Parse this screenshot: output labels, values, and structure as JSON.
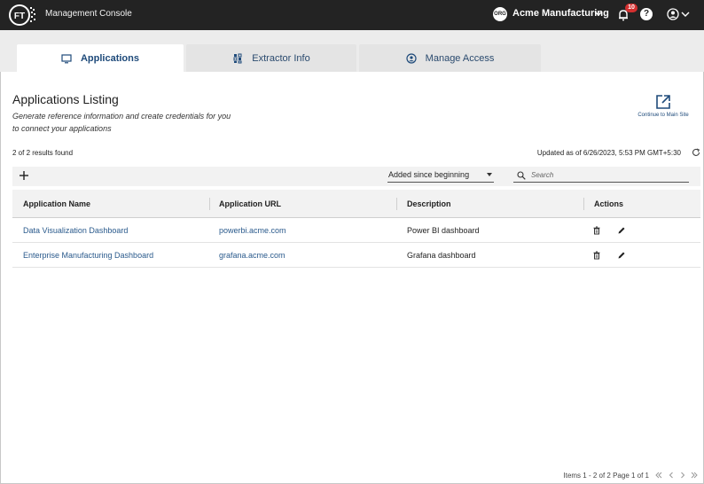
{
  "topbar": {
    "logo_text": "FT",
    "app_title": "Management Console",
    "org_icon_text": "ORG",
    "org_name": "Acme Manufacturing",
    "notification_count": "10",
    "help_label": "?"
  },
  "tabs": [
    {
      "label": "Applications",
      "icon": "monitor-icon",
      "active": true
    },
    {
      "label": "Extractor Info",
      "icon": "grid-icon",
      "active": false
    },
    {
      "label": "Manage Access",
      "icon": "user-circle-icon",
      "active": false
    }
  ],
  "header": {
    "title": "Applications Listing",
    "subtitle": "Generate reference information and create credentials for you to connect your applications",
    "external_link_label": "Continue to Main Site"
  },
  "status": {
    "results_text": "2 of 2 results found",
    "updated_text": "Updated as of 6/26/2023, 5:53 PM GMT+5:30"
  },
  "toolbar": {
    "filter_value": "Added since beginning",
    "search_placeholder": "Search"
  },
  "table": {
    "columns": [
      "Application Name",
      "Application URL",
      "Description",
      "Actions"
    ],
    "rows": [
      {
        "name": "Data Visualization Dashboard",
        "url": "powerbi.acme.com",
        "description": "Power BI dashboard"
      },
      {
        "name": "Enterprise Manufacturing Dashboard",
        "url": "grafana.acme.com",
        "description": "Grafana dashboard"
      }
    ]
  },
  "footer": {
    "pager_text": "Items 1 - 2 of 2  Page 1 of 1"
  },
  "colors": {
    "topbar_bg": "#232323",
    "accent": "#1e4a7a",
    "link": "#2a5a8c",
    "badge": "#d32f2f"
  }
}
